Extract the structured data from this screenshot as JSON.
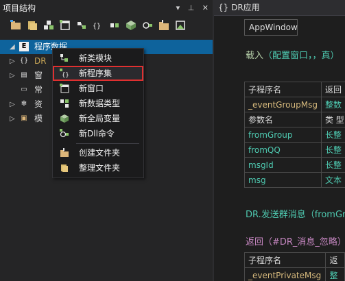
{
  "panel": {
    "title": "项目结构",
    "ctrl_dropdown": "▾",
    "ctrl_pin": "⊥",
    "ctrl_close": "✕"
  },
  "tree": [
    {
      "expander": "◢",
      "icon": "E",
      "label": "程序数据",
      "selected": true
    },
    {
      "expander": "▷",
      "icon": "{}",
      "label": "DR"
    },
    {
      "expander": "▷",
      "icon": "▤",
      "label": "窗"
    },
    {
      "expander": "",
      "icon": "▭",
      "label": "常"
    },
    {
      "expander": "▷",
      "icon": "✻",
      "label": "资"
    },
    {
      "expander": "▷",
      "icon": "▣",
      "label": "模"
    }
  ],
  "context_menu": {
    "items": [
      {
        "label": "新类模块",
        "icon": "new-class-icon"
      },
      {
        "label": "新程序集",
        "icon": "new-assembly-icon",
        "highlighted": true
      },
      {
        "label": "新窗口",
        "icon": "new-window-icon"
      },
      {
        "label": "新数据类型",
        "icon": "new-datatype-icon"
      },
      {
        "label": "新全局变量",
        "icon": "new-global-var-icon"
      },
      {
        "label": "新Dll命令",
        "icon": "new-dll-icon"
      },
      {
        "label": "创建文件夹",
        "icon": "create-folder-icon"
      },
      {
        "label": "整理文件夹",
        "icon": "organize-folder-icon"
      }
    ]
  },
  "editor": {
    "tab_title": "{} DR应用",
    "window_name": "AppWindow",
    "line1_prefix": "载入",
    "line1_args": "（配置窗口，，真）",
    "table1_headers": [
      "子程序名",
      "返回"
    ],
    "table1_row": [
      "_eventGroupMsg",
      "整数"
    ],
    "table1_param_headers": [
      "参数名",
      "类 型"
    ],
    "table1_params": [
      [
        "fromGroup",
        "长整"
      ],
      [
        "fromQQ",
        "长整"
      ],
      [
        "msgId",
        "长整"
      ],
      [
        "msg",
        "文本"
      ]
    ],
    "line2_text": "DR.发送群消息（fromGr",
    "line3_text": "返回（#DR_消息_忽略）",
    "table2_headers": [
      "子程序名",
      "返"
    ],
    "table2_row": [
      "_eventPrivateMsg",
      "整"
    ]
  }
}
